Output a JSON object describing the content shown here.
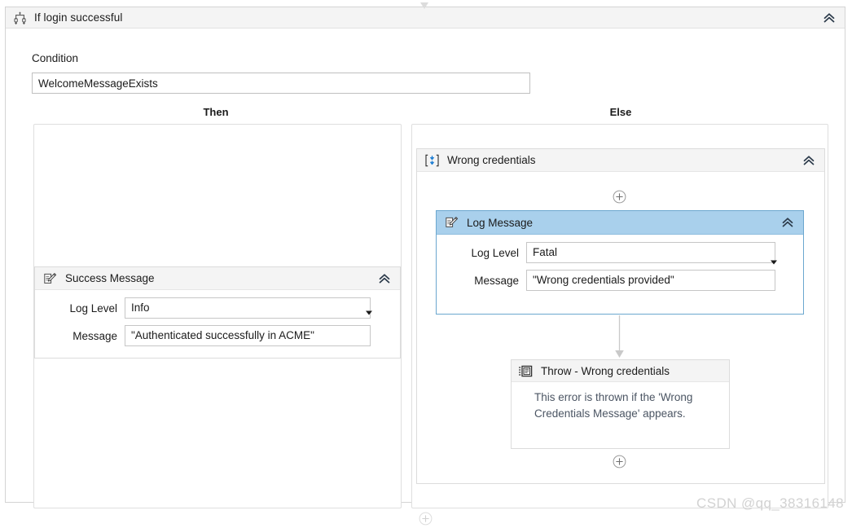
{
  "activity": {
    "title": "If login successful",
    "icon": "if-branch-icon",
    "collapse_icon": "chevron-up-double-icon",
    "top_connector_icon": "arrow-down-icon"
  },
  "condition": {
    "label": "Condition",
    "value": "WelcomeMessageExists",
    "placeholder": ""
  },
  "branches": {
    "then_label": "Then",
    "else_label": "Else"
  },
  "then_branch": {
    "activities": [
      {
        "title": "Success Message",
        "icon": "log-message-icon",
        "collapse_icon": "chevron-up-double-icon",
        "fields": [
          {
            "label": "Log Level",
            "value": "Info",
            "type": "combobox",
            "arrow_icon": "chevron-down-icon"
          },
          {
            "label": "Message",
            "value": "\"Authenticated successfully in ACME\"",
            "type": "textbox"
          }
        ]
      }
    ]
  },
  "else_branch": {
    "sequence": {
      "title": "Wrong credentials",
      "icon": "sequence-icon",
      "collapse_icon": "chevron-up-double-icon",
      "add_top_icon": "plus-circle-icon",
      "add_bottom_icon": "plus-circle-icon",
      "connector_icon": "arrow-down-icon",
      "log_message": {
        "title": "Log Message",
        "icon": "log-message-icon",
        "collapse_icon": "chevron-up-double-icon",
        "selected": true,
        "fields": [
          {
            "label": "Log Level",
            "value": "Fatal",
            "type": "combobox",
            "arrow_icon": "chevron-down-icon"
          },
          {
            "label": "Message",
            "value": "\"Wrong credentials provided\"",
            "type": "textbox"
          }
        ]
      },
      "throw": {
        "title": "Throw - Wrong credentials",
        "icon": "throw-icon",
        "description": "This error is thrown if the 'Wrong Credentials Message' appears."
      }
    }
  },
  "watermark": "CSDN @qq_38316148",
  "colors": {
    "selection_header": "#a9d0ec",
    "selection_border": "#6ba7cf",
    "panel_header": "#f4f4f4",
    "panel_border": "#dcdcdc",
    "icon_blue": "#1f7fd4",
    "text": "#1b1b1b",
    "muted_text": "#4b5563"
  }
}
